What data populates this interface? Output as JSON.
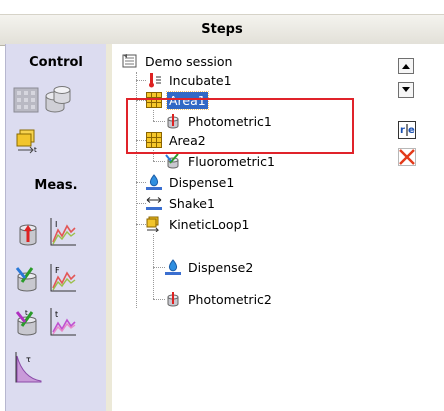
{
  "header": {
    "title": "Steps"
  },
  "sidebar": {
    "control_heading": "Control",
    "meas_heading": "Meas.",
    "tools": [
      {
        "name": "plate-icon"
      },
      {
        "name": "cylinder-icon"
      },
      {
        "name": "move-plate-icon"
      },
      {
        "name": "absorbance-single-icon"
      },
      {
        "name": "absorbance-curve-icon"
      },
      {
        "name": "fluorescence-single-icon"
      },
      {
        "name": "fluorescence-curve-icon"
      },
      {
        "name": "luminescence-single-icon"
      },
      {
        "name": "luminescence-curve-icon"
      },
      {
        "name": "decay-curve-icon"
      }
    ]
  },
  "tree": {
    "root": "Demo session",
    "items": [
      {
        "label": "Incubate1",
        "icon": "incubate-icon"
      },
      {
        "label": "Area1",
        "icon": "area-grid-icon",
        "selected": true
      },
      {
        "label": "Photometric1",
        "icon": "photometric-icon"
      },
      {
        "label": "Area2",
        "icon": "area-grid-icon"
      },
      {
        "label": "Fluorometric1",
        "icon": "fluorometric-icon"
      },
      {
        "label": "Dispense1",
        "icon": "dispense-icon"
      },
      {
        "label": "Shake1",
        "icon": "shake-icon"
      },
      {
        "label": "KineticLoop1",
        "icon": "kinetic-loop-icon"
      },
      {
        "label": "Dispense2",
        "icon": "dispense-icon"
      },
      {
        "label": "Photometric2",
        "icon": "photometric-icon"
      }
    ]
  },
  "toolbar": {
    "up": "move-up-icon",
    "down": "move-down-icon",
    "rename": "rename-icon",
    "delete": "delete-icon"
  },
  "colors": {
    "selection": "#3169c6",
    "highlight_box": "#e0232a",
    "sidebar": "#dcdcf0"
  }
}
